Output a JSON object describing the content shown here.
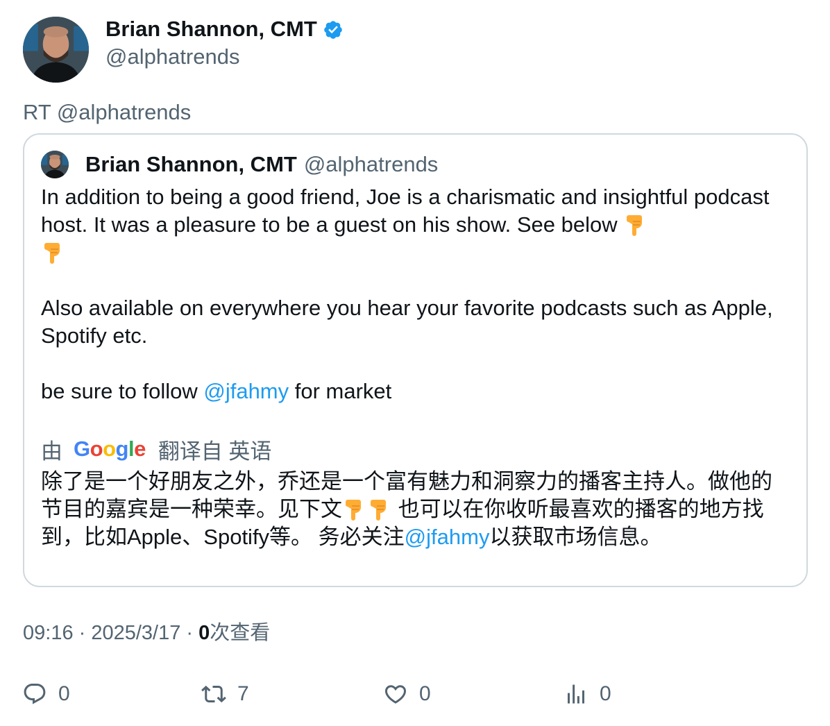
{
  "author": {
    "display_name": "Brian Shannon, CMT",
    "handle": "@alphatrends",
    "verified_icon": "verified-badge-icon",
    "verified_color": "#1d9bf0"
  },
  "tweet": {
    "text": "RT @alphatrends"
  },
  "quoted": {
    "display_name": "Brian Shannon, CMT",
    "handle": "@alphatrends",
    "para1": "In addition to being a good friend, Joe is a charismatic and insightful podcast host.  It was a pleasure to be a guest on his show.  See below",
    "para2": "Also available on everywhere you hear your favorite podcasts such as Apple, Spotify etc.",
    "para3_before": "be sure to follow ",
    "para3_mention": "@jfahmy",
    "para3_after": " for market",
    "emoji_icon": "pointing-down-hand-icon"
  },
  "translation": {
    "prefix": "由",
    "provider": "Google",
    "suffix": "翻译自 英语",
    "text_before": "除了是一个好朋友之外，乔还是一个富有魅力和洞察力的播客主持人。做他的节目的嘉宾是一种荣幸。见下文",
    "text_middle": " 也可以在你收听最喜欢的播客的地方找到，比如Apple、Spotify等。 务必关注",
    "mention": "@jfahmy",
    "text_after": "以获取市场信息。"
  },
  "meta": {
    "time": "09:16",
    "separator": " · ",
    "date": "2025/3/17",
    "views_count": "0",
    "views_label": "次查看"
  },
  "actions": {
    "replies": "0",
    "retweets": "7",
    "likes": "0",
    "views": "0"
  },
  "colors": {
    "text_primary": "#0f1419",
    "text_secondary": "#536471",
    "link": "#1d9bf0",
    "border": "#cfd9de"
  }
}
